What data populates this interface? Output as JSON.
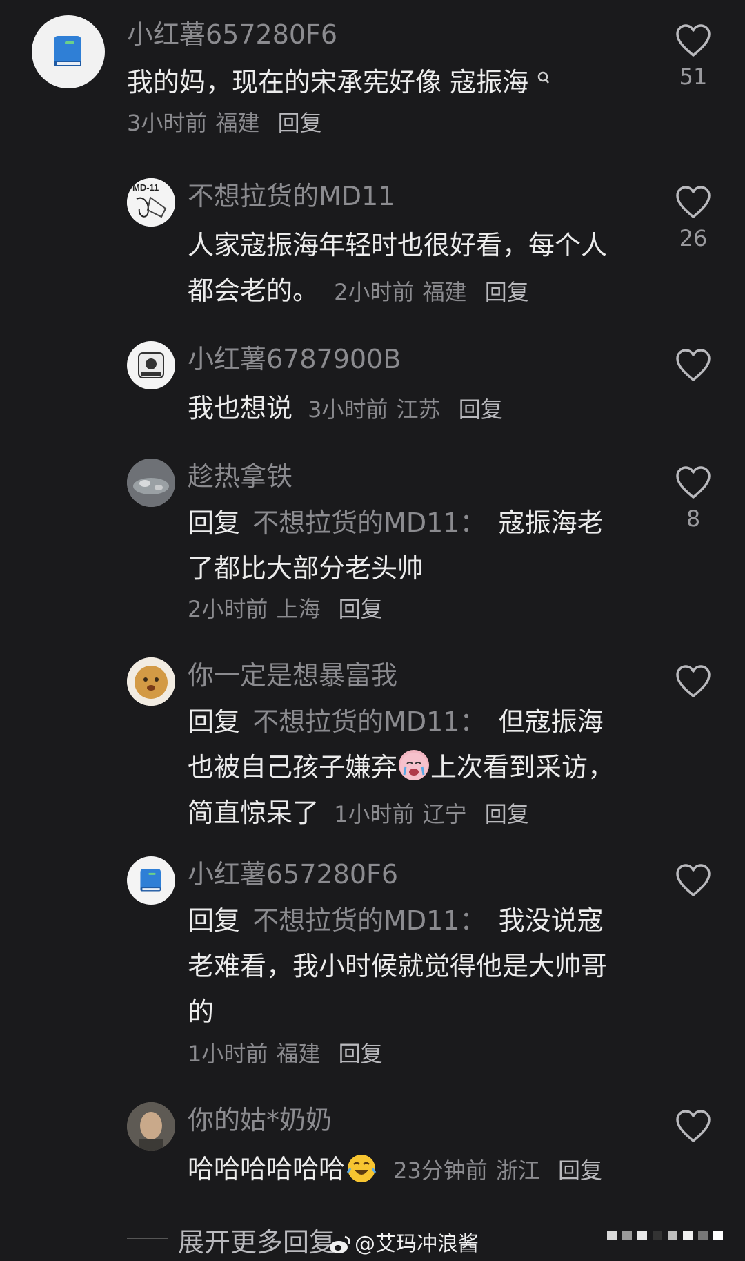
{
  "comments": [
    {
      "username": "小红薯657280F6",
      "text": "我的妈，现在的宋承宪好像 寇振海",
      "time": "3小时前",
      "location": "福建",
      "reply_label": "回复",
      "likes": "51",
      "avatar_icon": "book-icon"
    },
    {
      "username": "不想拉货的MD11",
      "text": "人家寇振海年轻时也很好看，每个人都会老的。",
      "time": "2小时前",
      "location": "福建",
      "reply_label": "回复",
      "likes": "26",
      "avatar_icon": "md11-logo-avatar"
    },
    {
      "username": "小红薯6787900B",
      "text": "我也想说",
      "time": "3小时前",
      "location": "江苏",
      "reply_label": "回复",
      "likes": "",
      "avatar_icon": "camera-icon"
    },
    {
      "username": "趁热拿铁",
      "reply_prefix": "回复",
      "reply_to": "不想拉货的MD11：",
      "text": "寇振海老了都比大部分老头帅",
      "time": "2小时前",
      "location": "上海",
      "reply_label": "回复",
      "likes": "8",
      "avatar_icon": "photo-avatar"
    },
    {
      "username": "你一定是想暴富我",
      "reply_prefix": "回复",
      "reply_to": "不想拉货的MD11：",
      "text_a": "但寇振海也被自己孩子嫌弃",
      "emoji": "crying-face-emoji",
      "text_b": "上次看到采访，简直惊呆了",
      "time": "1小时前",
      "location": "辽宁",
      "reply_label": "回复",
      "likes": "",
      "avatar_icon": "cookie-avatar"
    },
    {
      "username": "小红薯657280F6",
      "reply_prefix": "回复",
      "reply_to": "不想拉货的MD11：",
      "text": "我没说寇老难看，我小时候就觉得他是大帅哥的",
      "time": "1小时前",
      "location": "福建",
      "reply_label": "回复",
      "likes": "",
      "avatar_icon": "book-icon"
    },
    {
      "username": "你的姑*奶奶",
      "text": "哈哈哈哈哈哈",
      "emoji": "laughing-face-emoji",
      "time": "23分钟前",
      "location": "浙江",
      "reply_label": "回复",
      "likes": "",
      "avatar_icon": "face-photo-avatar"
    }
  ],
  "footer": {
    "expand_label": "展开更多回复",
    "watermark": "@艾玛冲浪酱"
  },
  "colors": {
    "background": "#1a1a1c",
    "primary_text": "#ececec",
    "secondary_text": "#8b8b8f",
    "book_blue": "#2f7fd6"
  }
}
